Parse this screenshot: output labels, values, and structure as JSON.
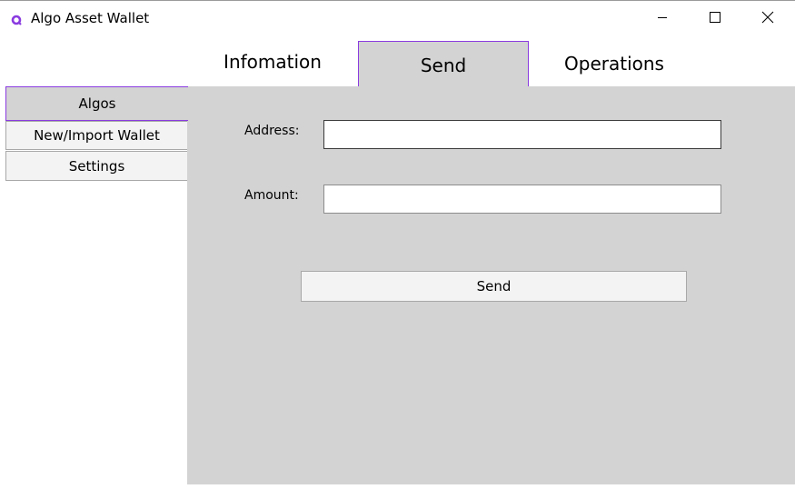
{
  "window": {
    "title": "Algo Asset Wallet",
    "icon": "algo-ring-icon",
    "accent_color": "#8a3be0",
    "controls": [
      "minimize-icon",
      "maximize-icon",
      "close-icon"
    ]
  },
  "tabs": [
    {
      "label": "Infomation",
      "selected": false
    },
    {
      "label": "Send",
      "selected": true
    },
    {
      "label": "Operations",
      "selected": false
    }
  ],
  "sidebar": {
    "items": [
      {
        "label": "Algos",
        "selected": true
      },
      {
        "label": "New/Import Wallet",
        "selected": false
      },
      {
        "label": "Settings",
        "selected": false
      }
    ]
  },
  "form": {
    "address_label": "Address:",
    "address_value": "",
    "amount_label": "Amount:",
    "amount_value": "",
    "send_button": "Send"
  }
}
